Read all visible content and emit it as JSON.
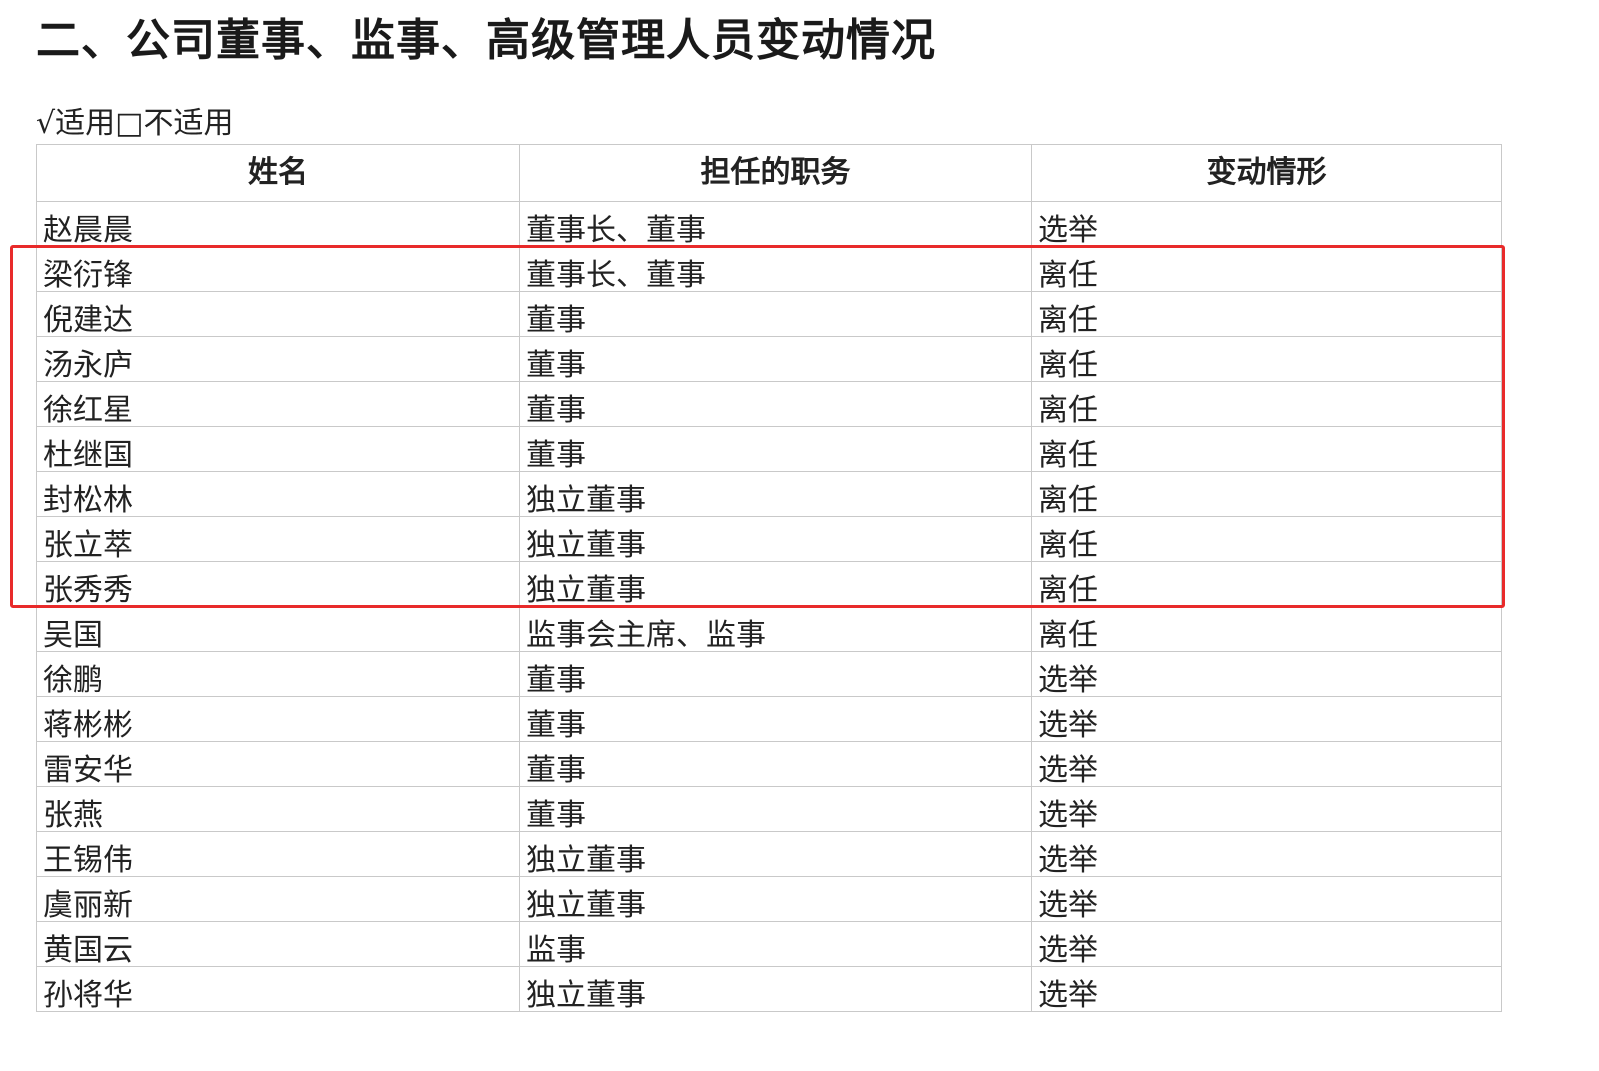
{
  "heading": "二、公司董事、监事、高级管理人员变动情况",
  "applicable_line": "√适用□不适用",
  "table": {
    "headers": [
      "姓名",
      "担任的职务",
      "变动情形"
    ],
    "rows": [
      [
        "赵晨晨",
        "董事长、董事",
        "选举"
      ],
      [
        "梁衍锋",
        "董事长、董事",
        "离任"
      ],
      [
        "倪建达",
        "董事",
        "离任"
      ],
      [
        "汤永庐",
        "董事",
        "离任"
      ],
      [
        "徐红星",
        "董事",
        "离任"
      ],
      [
        "杜继国",
        "董事",
        "离任"
      ],
      [
        "封松林",
        "独立董事",
        "离任"
      ],
      [
        "张立萃",
        "独立董事",
        "离任"
      ],
      [
        "张秀秀",
        "独立董事",
        "离任"
      ],
      [
        "吴国",
        "监事会主席、监事",
        "离任"
      ],
      [
        "徐鹏",
        "董事",
        "选举"
      ],
      [
        "蒋彬彬",
        "董事",
        "选举"
      ],
      [
        "雷安华",
        "董事",
        "选举"
      ],
      [
        "张燕",
        "董事",
        "选举"
      ],
      [
        "王锡伟",
        "独立董事",
        "选举"
      ],
      [
        "虞丽新",
        "独立董事",
        "选举"
      ],
      [
        "黄国云",
        "监事",
        "选举"
      ],
      [
        "孙将华",
        "独立董事",
        "选举"
      ]
    ]
  },
  "highlight": {
    "color": "#e82a2a",
    "first_row": 1,
    "last_row": 8
  }
}
